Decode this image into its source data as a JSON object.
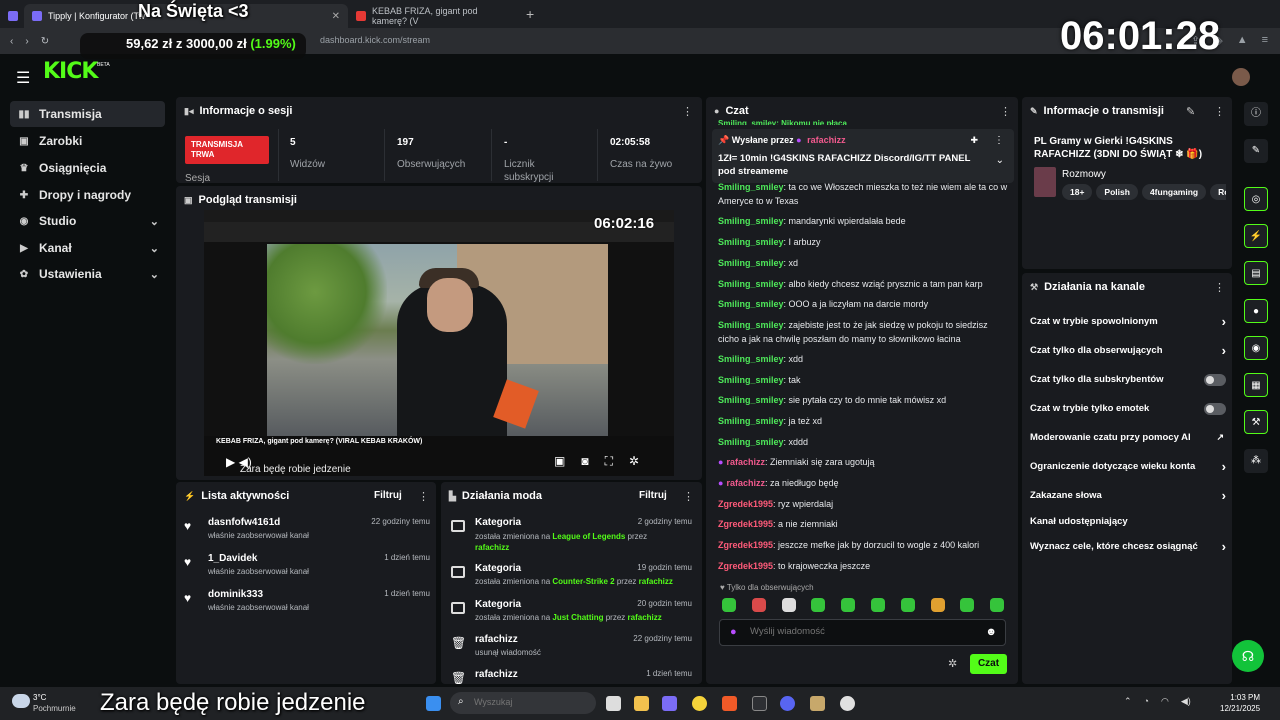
{
  "overlay": {
    "title": "Na Święta <3",
    "money_amount": "59,62 zł z 3000,00 zł",
    "money_pct": "(1.99%)",
    "clock": "06:01:28",
    "subtitle": "Zara będę robie jedzenie"
  },
  "browser": {
    "tabs": [
      {
        "label": "Tipply | Konfigurator (Tw"
      },
      {
        "label": "KEBAB FRIZA, gigant pod kamerę? (V"
      }
    ],
    "url": "dashboard.kick.com/stream"
  },
  "header": {
    "logo": "KICK",
    "beta": "BETA"
  },
  "sidebar": {
    "items": [
      {
        "label": "Transmisja",
        "icon": "broadcast-icon"
      },
      {
        "label": "Zarobki",
        "icon": "wallet-icon"
      },
      {
        "label": "Osiągnięcia",
        "icon": "trophy-icon"
      },
      {
        "label": "Dropy i nagrody",
        "icon": "gift-icon"
      },
      {
        "label": "Studio",
        "icon": "studio-icon"
      },
      {
        "label": "Kanał",
        "icon": "channel-icon"
      },
      {
        "label": "Ustawienia",
        "icon": "gear-icon"
      }
    ]
  },
  "session": {
    "title": "Informacje o sesji",
    "live_badge": "TRANSMISJA TRWA",
    "session_label": "Sesja",
    "stats": [
      {
        "value": "5",
        "label": "Widzów"
      },
      {
        "value": "197",
        "label": "Obserwujących"
      },
      {
        "value": "-",
        "label": "Licznik subskrypcji"
      },
      {
        "value": "02:05:58",
        "label": "Czas na żywo"
      }
    ]
  },
  "preview": {
    "title": "Podgląd transmisji",
    "clock": "06:02:16",
    "video_title": "KEBAB FRIZA, gigant pod kamerę? (VIRAL KEBAB KRAKÓW)",
    "subtitle": "Zara będę robie jedzenie"
  },
  "activity": {
    "title": "Lista aktywności",
    "filter": "Filtruj",
    "items": [
      {
        "name": "dasnfofw4161d",
        "sub": "właśnie zaobserwował kanał",
        "time": "22 godziny temu"
      },
      {
        "name": "1_Davidek",
        "sub": "właśnie zaobserwował kanał",
        "time": "1 dzień temu"
      },
      {
        "name": "dominik333",
        "sub": "właśnie zaobserwował kanał",
        "time": "1 dzień temu"
      }
    ]
  },
  "mod": {
    "title": "Działania moda",
    "filter": "Filtruj",
    "items": [
      {
        "name": "Kategoria",
        "time": "2 godziny temu",
        "pre": "została zmieniona na ",
        "hl": "League of Legends",
        "mid": " przez ",
        "who": "rafachizz"
      },
      {
        "name": "Kategoria",
        "time": "19 godzin temu",
        "pre": "została zmieniona na ",
        "hl": "Counter-Strike 2",
        "mid": " przez ",
        "who": "rafachizz"
      },
      {
        "name": "Kategoria",
        "time": "20 godzin temu",
        "pre": "została zmieniona na ",
        "hl": "Just Chatting",
        "mid": " przez ",
        "who": "rafachizz"
      },
      {
        "name": "rafachizz",
        "time": "22 godziny temu",
        "pre": "usunął wiadomość",
        "hl": "",
        "mid": "",
        "who": ""
      },
      {
        "name": "rafachizz",
        "time": "1 dzień temu",
        "pre": "",
        "hl": "",
        "mid": "",
        "who": ""
      }
    ]
  },
  "chat": {
    "title": "Czat",
    "top_fragment": "Smiling_smiley: Nikomu nie płacą",
    "pinned_by": "Wysłane przez",
    "pinned_user": "rafachizz",
    "pinned_text": "1Zł= 10min !G4SKINS RAFACHIZZ Discord/IG/TT PANEL pod streameme",
    "messages": [
      {
        "user": "Smiling_smiley",
        "text": ": ta co we Włoszech mieszka to też nie wiem ale ta co w Ameryce to w Texas",
        "color": "green"
      },
      {
        "user": "Smiling_smiley",
        "text": ": mandarynki wpierdalała bede",
        "color": "green"
      },
      {
        "user": "Smiling_smiley",
        "text": ": I arbuzy",
        "color": "green"
      },
      {
        "user": "Smiling_smiley",
        "text": ": xd",
        "color": "green"
      },
      {
        "user": "Smiling_smiley",
        "text": ": albo kiedy chcesz wziąć prysznic a tam pan karp",
        "color": "green"
      },
      {
        "user": "Smiling_smiley",
        "text": ": OOO a ja liczyłam na darcie mordy",
        "color": "green"
      },
      {
        "user": "Smiling_smiley",
        "text": ": zajebiste jest to że jak siedzę w pokoju to siedzisz cicho a jak na chwilę poszłam do mamy to słownikowo łacina",
        "color": "green"
      },
      {
        "user": "Smiling_smiley",
        "text": ": xdd",
        "color": "green"
      },
      {
        "user": "Smiling_smiley",
        "text": ": tak",
        "color": "green"
      },
      {
        "user": "Smiling_smiley",
        "text": ": sie pytała czy to do mnie tak mówisz xd",
        "color": "green"
      },
      {
        "user": "Smiling_smiley",
        "text": ": ja też xd",
        "color": "green"
      },
      {
        "user": "Smiling_smiley",
        "text": ": xddd",
        "color": "green"
      },
      {
        "user": "rafachizz",
        "text": ": Ziemniaki się zara ugotują",
        "color": "pink"
      },
      {
        "user": "rafachizz",
        "text": ": za niedługo będę",
        "color": "pink"
      },
      {
        "user": "Zgredek1995",
        "text": ": ryz wpierdalaj",
        "color": "red"
      },
      {
        "user": "Zgredek1995",
        "text": ": a nie ziemniaki",
        "color": "red"
      },
      {
        "user": "Zgredek1995",
        "text": ": jeszcze mefke jak by dorzucil to wogle z 400 kalori",
        "color": "red"
      },
      {
        "user": "Zgredek1995",
        "text": ": to krajoweczka jeszcze",
        "color": "red"
      }
    ],
    "followers_only": "Tylko dla obserwujących",
    "input_placeholder": "Wyślij wiadomość",
    "send": "Czat"
  },
  "stream_info": {
    "title": "Informacje o transmisji",
    "stream_title": "PL Gramy w Gierki !G4SKINS RAFACHIZZ (3DNI DO ŚWIĄT ❄ 🎁)",
    "category": "Rozmowy",
    "tags": [
      "18+",
      "Polish",
      "4fungaming",
      "Rolepl"
    ]
  },
  "channel_actions": {
    "title": "Działania na kanale",
    "items": [
      {
        "label": "Czat w trybie spowolnionym",
        "kind": "arrow"
      },
      {
        "label": "Czat tylko dla obserwujących",
        "kind": "arrow"
      },
      {
        "label": "Czat tylko dla subskrybentów",
        "kind": "toggle"
      },
      {
        "label": "Czat w trybie tylko emotek",
        "kind": "toggle"
      },
      {
        "label": "Moderowanie czatu przy pomocy AI",
        "kind": "external"
      },
      {
        "label": "Ograniczenie dotyczące wieku konta",
        "kind": "arrow"
      },
      {
        "label": "Zakazane słowa",
        "kind": "arrow"
      },
      {
        "label": "Kanał udostępniający",
        "kind": "none"
      },
      {
        "label": "Wyznacz cele, które chcesz osiągnąć",
        "kind": "arrow"
      }
    ]
  },
  "taskbar": {
    "temp": "3°C",
    "weather": "Pochmurnie",
    "search_placeholder": "Wyszukaj",
    "time": "1:03 PM",
    "date": "12/21/2025"
  }
}
